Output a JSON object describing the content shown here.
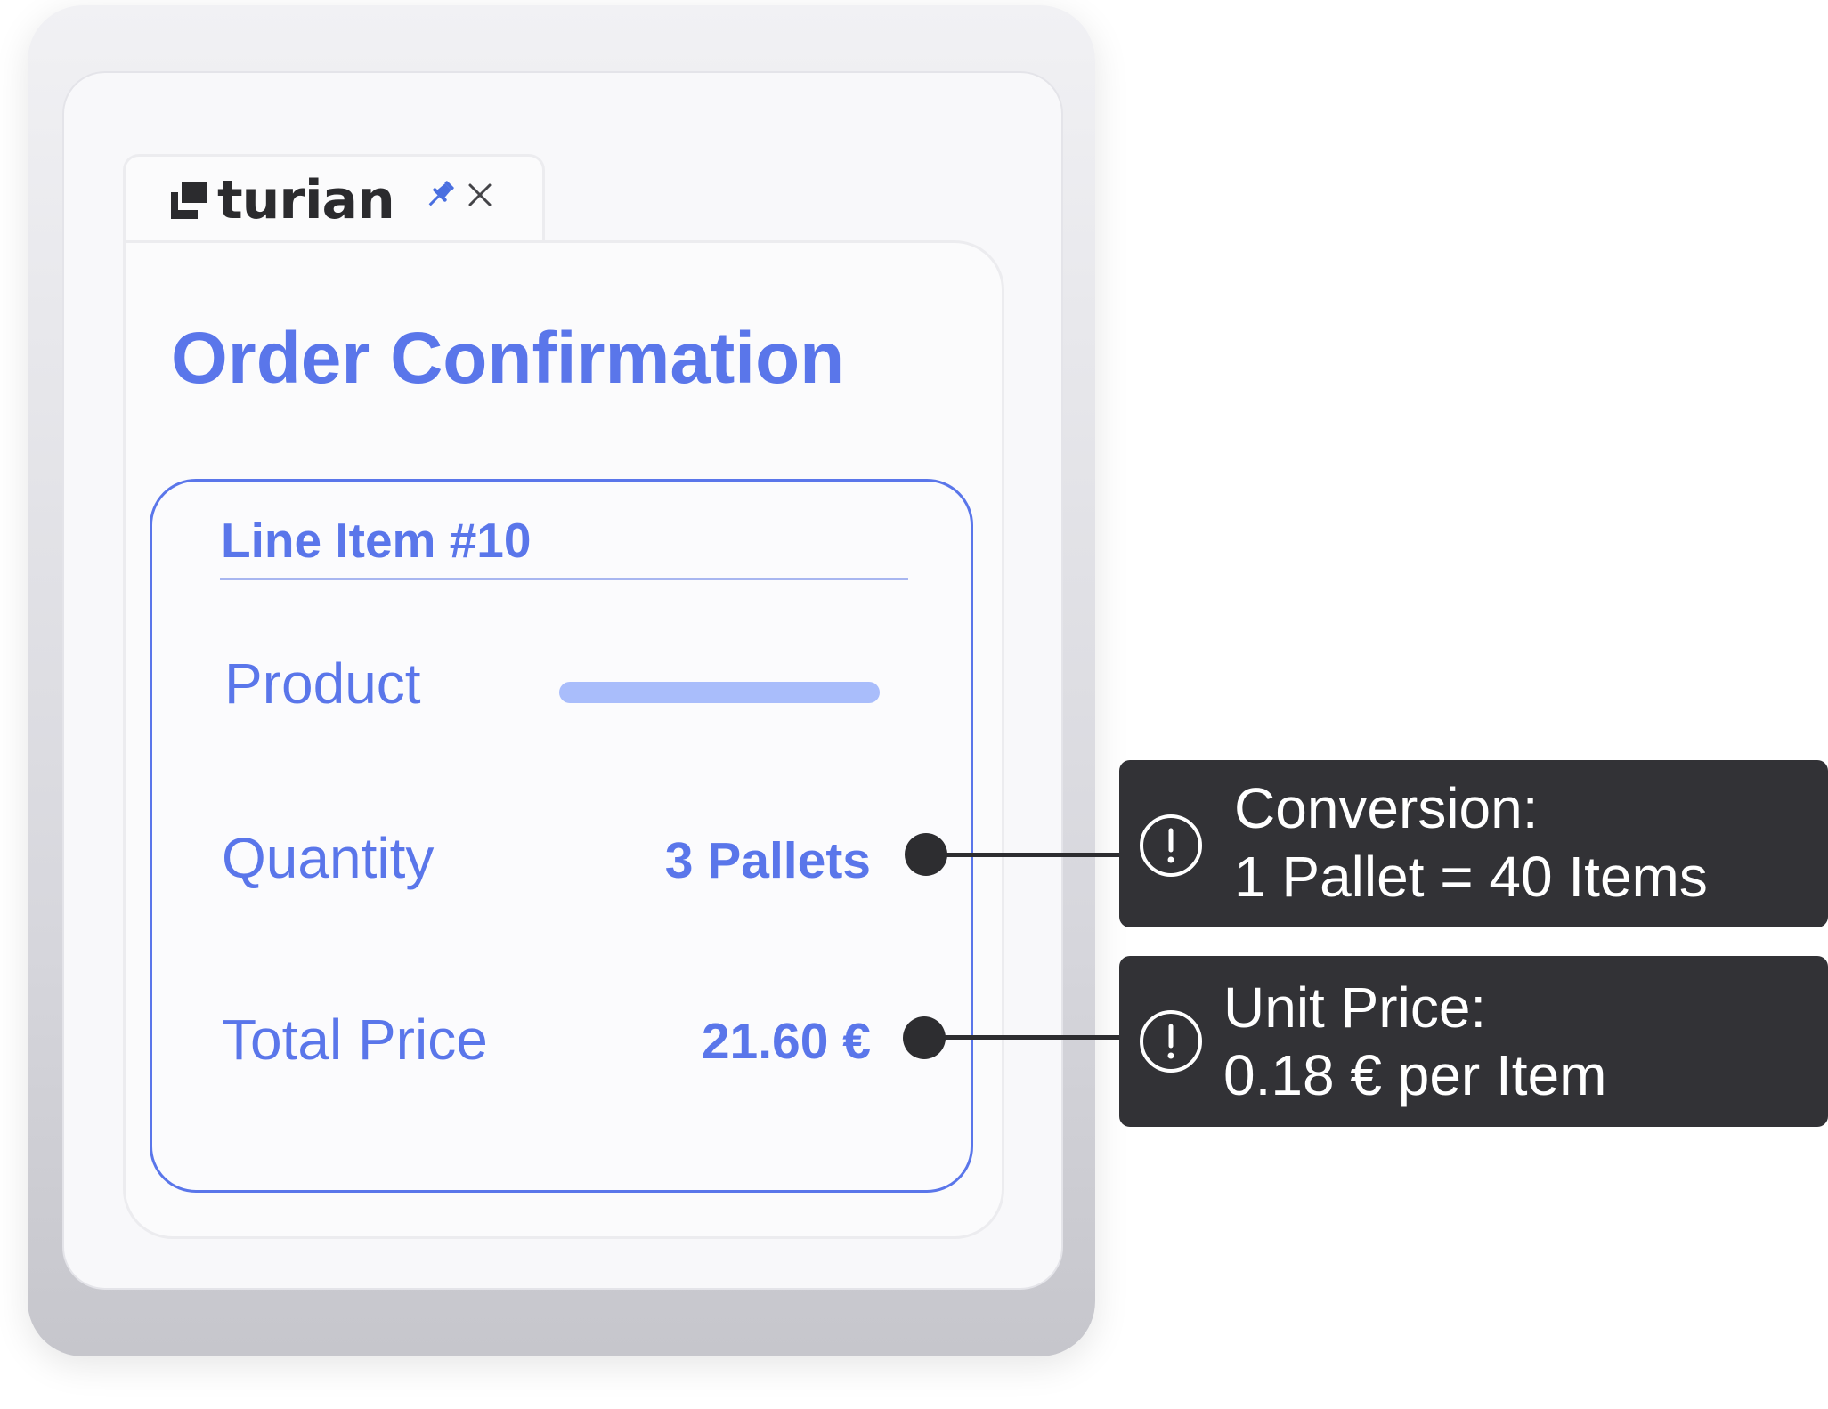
{
  "browser_tab": {
    "brand_name": "turian",
    "pin_icon": "pin-icon",
    "close_icon": "close-icon"
  },
  "page": {
    "title": "Order Confirmation"
  },
  "line_item": {
    "title": "Line Item #10",
    "fields": {
      "product": {
        "label": "Product"
      },
      "quantity": {
        "label": "Quantity",
        "value": "3 Pallets"
      },
      "total_price": {
        "label": "Total Price",
        "value": "21.60 €"
      }
    }
  },
  "tooltips": {
    "conversion": {
      "icon": "alert-circle-icon",
      "line1": "Conversion:",
      "line2": "1 Pallet = 40 Items"
    },
    "unit_price": {
      "icon": "alert-circle-icon",
      "line1": "Unit Price:",
      "line2": "0.18 € per Item"
    }
  },
  "colors": {
    "accent": "#5a76ea",
    "accent_light": "#a9bdfb",
    "tooltip_bg": "#323236",
    "brand_text": "#2b2b2e",
    "pin": "#4a6fe0"
  }
}
